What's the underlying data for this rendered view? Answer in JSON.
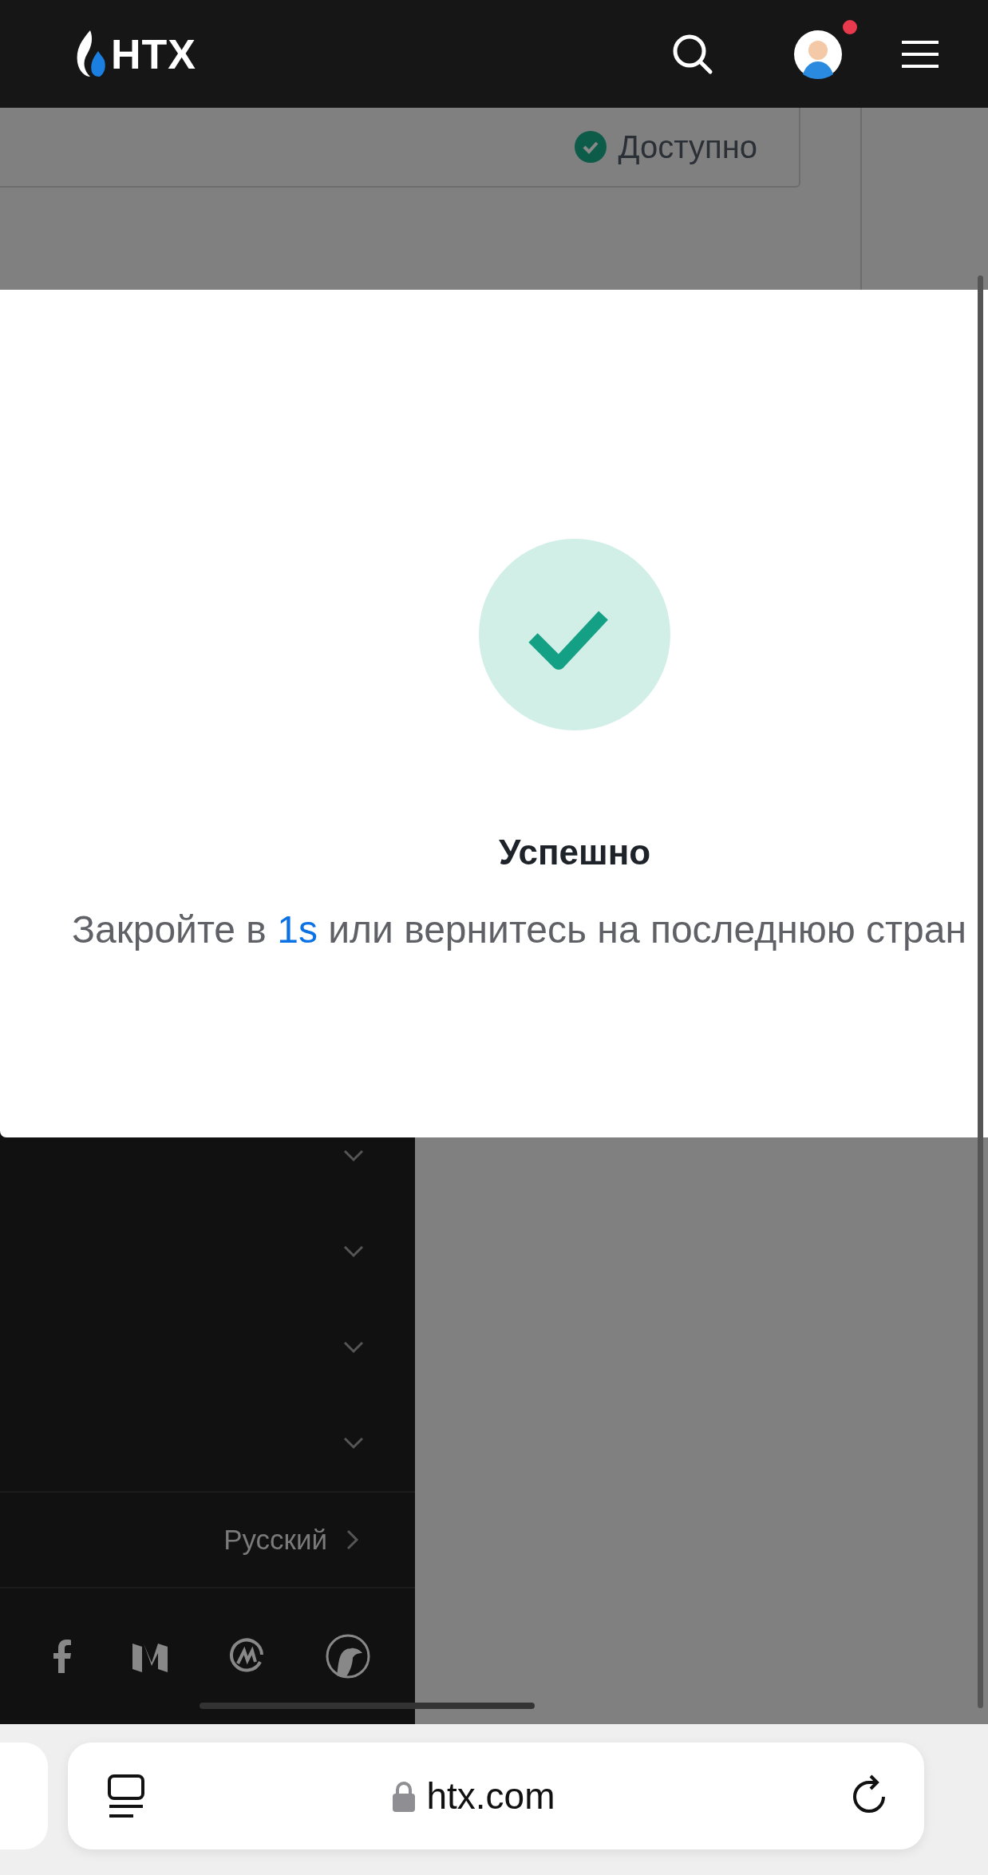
{
  "header": {
    "logo_text": "HTX"
  },
  "status": {
    "label": "Доступно"
  },
  "modal": {
    "title": "Успешно",
    "message": {
      "prefix": "Закройте в ",
      "countdown": "1s",
      "suffix": " или вернитесь на последнюю стран"
    }
  },
  "sidebar": {
    "items": [
      {
        "expanded": false
      },
      {
        "expanded": false
      },
      {
        "expanded": false
      },
      {
        "expanded": false
      }
    ],
    "language": "Русский"
  },
  "browser": {
    "url": "htx.com"
  }
}
